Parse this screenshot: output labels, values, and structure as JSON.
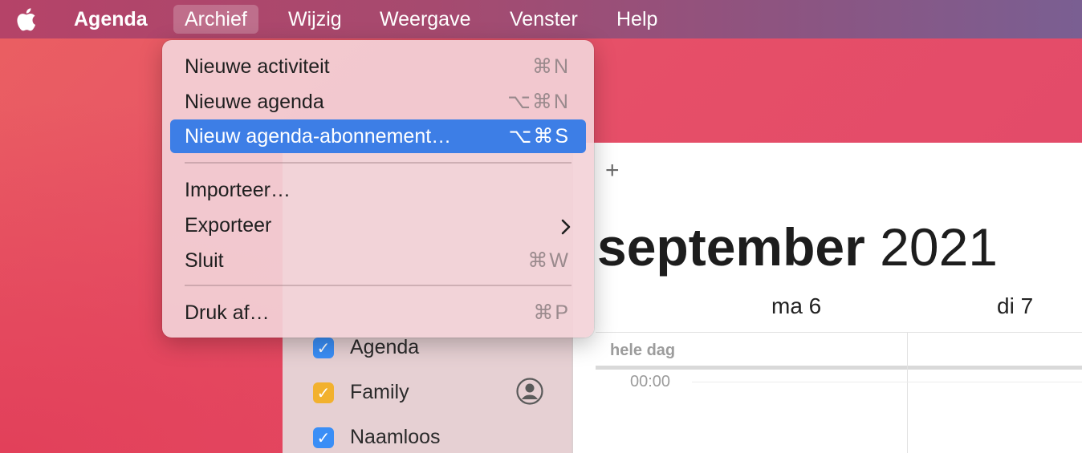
{
  "menubar": {
    "app_name": "Agenda",
    "menus": [
      "Archief",
      "Wijzig",
      "Weergave",
      "Venster",
      "Help"
    ]
  },
  "file_menu": {
    "items": [
      {
        "label": "Nieuwe activiteit",
        "shortcut": "⌘N"
      },
      {
        "label": "Nieuwe agenda",
        "shortcut": "⌥⌘N"
      },
      {
        "label": "Nieuw agenda-abonnement…",
        "shortcut": "⌥⌘S",
        "highlighted": true
      },
      {
        "label": "Importeer…",
        "shortcut": ""
      },
      {
        "label": "Exporteer",
        "shortcut": "",
        "submenu": true
      },
      {
        "label": "Sluit",
        "shortcut": "⌘W"
      },
      {
        "label": "Druk af…",
        "shortcut": "⌘P"
      }
    ]
  },
  "calendar": {
    "add_symbol": "+",
    "month": "september",
    "year": "2021",
    "days": [
      "ma 6",
      "di 7"
    ],
    "allday_label": "hele dag",
    "time_label": "00:00"
  },
  "sidebar": {
    "calendars": [
      {
        "name": "Agenda",
        "color": "#3a8ef6",
        "checked": true
      },
      {
        "name": "Family",
        "color": "#f2b12e",
        "checked": true,
        "shared": true
      },
      {
        "name": "Naamloos",
        "color": "#3a8ef6",
        "checked": true
      }
    ]
  },
  "icons": {
    "apple": "apple-logo-icon",
    "submenu_arrow": "chevron-right-icon",
    "shared": "person-circle-icon",
    "checkmark": "checkmark-icon"
  }
}
